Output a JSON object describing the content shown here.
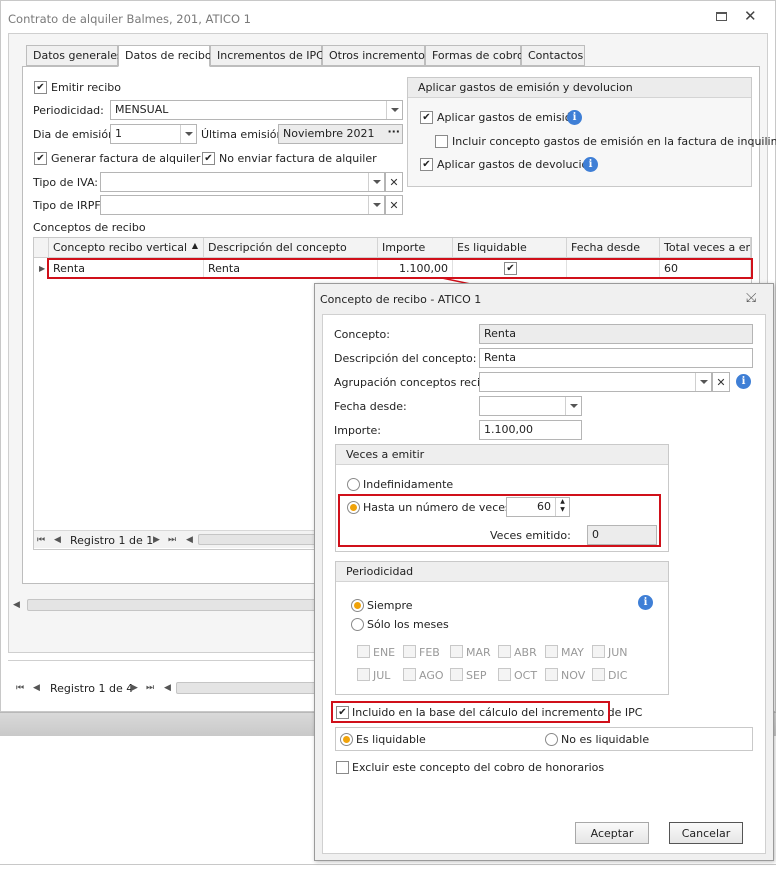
{
  "window": {
    "title": "Contrato de alquiler Balmes, 201, ATICO 1"
  },
  "tabs": [
    "Datos generales",
    "Datos de recibo",
    "Incrementos de IPC",
    "Otros incrementos",
    "Formas de cobro",
    "Contactos"
  ],
  "recibo": {
    "emitir_recibo": "Emitir recibo",
    "periodicidad_label": "Periodicidad:",
    "periodicidad_value": "MENSUAL",
    "dia_emision_label": "Dia de emisión:",
    "dia_emision_value": "1",
    "ultima_emision_label": "Última emisión:",
    "ultima_emision_value": "Noviembre 2021",
    "generar_factura": "Generar factura de alquiler",
    "no_enviar_factura": "No enviar factura de alquiler",
    "tipo_iva_label": "Tipo de IVA:",
    "tipo_irpf_label": "Tipo de IRPF:",
    "conceptos_label": "Conceptos de recibo"
  },
  "gastos": {
    "title": "Aplicar gastos de emisión y devolucion",
    "aplicar_emision": "Aplicar gastos de emisión",
    "incluir_concepto": "Incluir concepto gastos de emisión en la factura de inquilino",
    "aplicar_devolucion": "Aplicar gastos de devolución"
  },
  "grid": {
    "columns": [
      "Concepto recibo vertical",
      "Descripción del concepto",
      "Importe",
      "Es liquidable",
      "Fecha desde",
      "Total veces a emit"
    ],
    "rows": [
      {
        "concepto": "Renta",
        "descripcion": "Renta",
        "importe": "1.100,00",
        "fecha": "",
        "total": "60"
      }
    ],
    "record_nav": "Registro 1 de 1"
  },
  "outer_nav": "Registro 1 de 4",
  "dialog": {
    "title": "Concepto de recibo - ATICO 1",
    "concepto_label": "Concepto:",
    "concepto_value": "Renta",
    "descripcion_label": "Descripción del concepto:",
    "descripcion_value": "Renta",
    "agrupacion_label": "Agrupación conceptos recibo:",
    "fecha_label": "Fecha desde:",
    "importe_label": "Importe:",
    "importe_value": "1.100,00",
    "veces_title": "Veces a emitir",
    "indefinidamente": "Indefinidamente",
    "hasta_numero": "Hasta un número de veces",
    "hasta_value": "60",
    "veces_emitido_label": "Veces emitido:",
    "veces_emitido_value": "0",
    "periodicidad_title": "Periodicidad",
    "siempre": "Siempre",
    "solo_meses": "Sólo los meses",
    "months_row1": [
      "ENE",
      "FEB",
      "MAR",
      "ABR",
      "MAY",
      "JUN"
    ],
    "months_row2": [
      "JUL",
      "AGO",
      "SEP",
      "OCT",
      "NOV",
      "DIC"
    ],
    "incluido_ipc": "Incluido en la base del cálculo del incremento de IPC",
    "es_liquidable": "Es liquidable",
    "no_es_liquidable": "No es liquidable",
    "excluir_honorarios": "Excluir este concepto del cobro de honorarios",
    "aceptar": "Aceptar",
    "cancelar": "Cancelar"
  },
  "colors": {
    "accent_radio": "#f0a30a",
    "highlight_red": "#d0101a",
    "info_blue": "#3f7fd6"
  }
}
